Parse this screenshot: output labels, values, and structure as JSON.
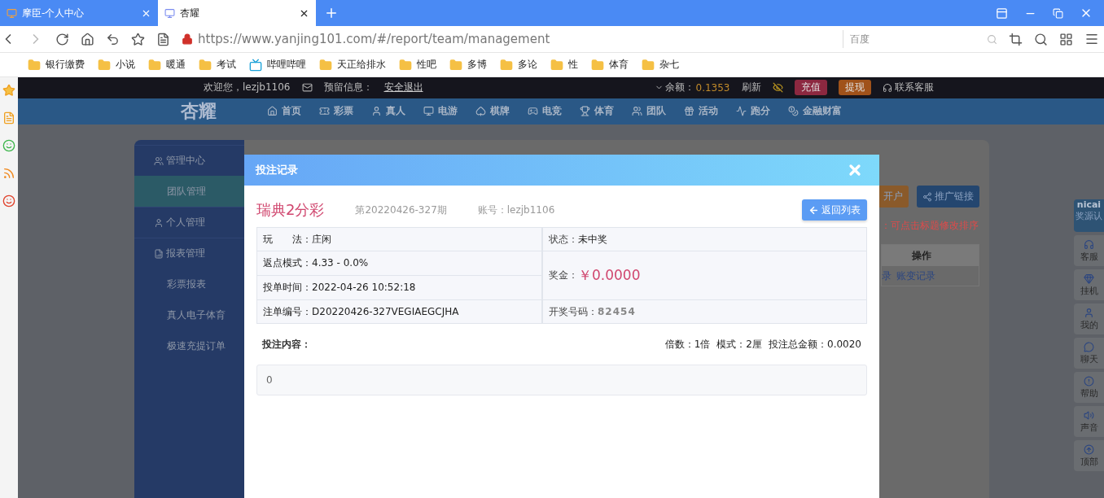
{
  "browser": {
    "tabs": [
      {
        "title": "摩臣-个人中心",
        "selected": false
      },
      {
        "title": "杏耀",
        "selected": true
      }
    ],
    "address": "https://www.yanjing101.com/#/report/team/management",
    "search_placeholder": "百度",
    "bookmarks": [
      {
        "label": "银行缴费",
        "kind": "folder"
      },
      {
        "label": "小说",
        "kind": "folder"
      },
      {
        "label": "暖通",
        "kind": "folder"
      },
      {
        "label": "考试",
        "kind": "folder"
      },
      {
        "label": "哔哩哔哩",
        "kind": "tv"
      },
      {
        "label": "天正给排水",
        "kind": "folder"
      },
      {
        "label": "性吧",
        "kind": "folder"
      },
      {
        "label": "多博",
        "kind": "folder"
      },
      {
        "label": "多论",
        "kind": "folder"
      },
      {
        "label": "性",
        "kind": "folder"
      },
      {
        "label": "体育",
        "kind": "folder"
      },
      {
        "label": "杂七",
        "kind": "folder"
      }
    ]
  },
  "top_bar": {
    "welcome": "欢迎您，lezjb1106",
    "reserved": "预留信息：",
    "logout": "安全退出",
    "balance_label": "余额：",
    "balance": "0.1353",
    "refresh": "刷新",
    "deposit": "充值",
    "withdraw": "提现",
    "support": "联系客服"
  },
  "nav": {
    "logo": "杏耀",
    "items": [
      {
        "label": "首页"
      },
      {
        "label": "彩票"
      },
      {
        "label": "真人"
      },
      {
        "label": "电游"
      },
      {
        "label": "棋牌"
      },
      {
        "label": "电竞"
      },
      {
        "label": "体育"
      },
      {
        "label": "团队"
      },
      {
        "label": "活动"
      },
      {
        "label": "跑分"
      },
      {
        "label": "金融财富"
      }
    ]
  },
  "sidebar": {
    "groups": [
      {
        "label": "管理中心",
        "children": [
          {
            "label": "团队管理",
            "selected": true
          }
        ]
      },
      {
        "label": "个人管理"
      },
      {
        "label": "报表管理",
        "children": [
          {
            "label": "彩票报表",
            "selected": false
          },
          {
            "label": "真人电子体育",
            "selected": false
          },
          {
            "label": "极速充提订单",
            "selected": false
          }
        ]
      }
    ]
  },
  "panel": {
    "buttons": [
      "开户",
      "推广链接"
    ],
    "note": "：可点击标题修改排序",
    "table_header": "操作",
    "row_links": [
      "录",
      "账变记录"
    ]
  },
  "modal": {
    "title": "投注记录",
    "game": "瑞典2分彩",
    "issue": "第20220426-327期",
    "account": "账号：lezjb1106",
    "back_button": "返回列表",
    "left_fields": [
      {
        "label": "玩　　法：",
        "value": "庄闲"
      },
      {
        "label": "返点模式：",
        "value": "4.33 - 0.0%"
      },
      {
        "label": "投单时间：",
        "value": "2022-04-26 10:52:18"
      },
      {
        "label": "注单编号：",
        "value": "D20220426-327VEGIAEGCJHA"
      }
    ],
    "right_fields": [
      {
        "label": "状态：",
        "value": "未中奖",
        "kind": "plain"
      },
      {
        "label": "奖金：",
        "value": "￥0.0000",
        "kind": "prize"
      },
      {
        "label": "开奖号码：",
        "value": "82454",
        "kind": "number"
      }
    ],
    "content_label": "投注内容：",
    "multiplier": "倍数：1倍",
    "mode": "模式：2厘",
    "total": "投注总金额：0.0020",
    "content": "0"
  },
  "float_bar": {
    "logo": "nicai",
    "logo_caption": "奖源认",
    "items": [
      "客服",
      "挂机",
      "我的",
      "聊天",
      "帮助",
      "声音",
      "顶部"
    ]
  }
}
